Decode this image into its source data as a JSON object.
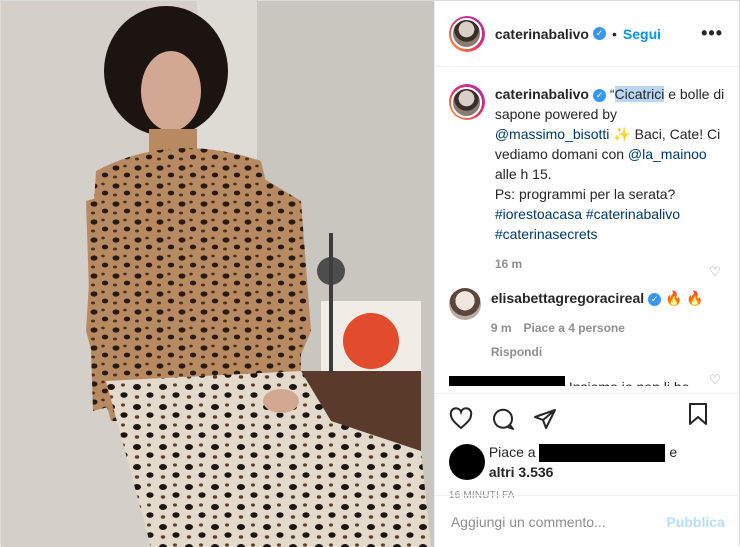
{
  "header": {
    "username": "caterinabalivo",
    "separator": "•",
    "follow_label": "Segui",
    "more_label": "•••"
  },
  "caption": {
    "username": "caterinabalivo",
    "quote": "“",
    "highlighted": "Cicatrici",
    "line1_rest": " e bolle di sapone powered by ",
    "mention1": "@massimo_bisotti",
    "sparkle": " ✨ ",
    "line2": "Baci, Cate! Ci vediamo domani con ",
    "mention2": "@la_mainoo",
    "line3": " alle h 15.",
    "line4": "Ps: programmi per la serata?",
    "hashtag1": "#iorestoacasa",
    "hashtag2": "#caterinabalivo",
    "hashtag3": "#caterinasecrets",
    "age": "16 m"
  },
  "comment1": {
    "username": "elisabettagregoracireal",
    "text": "🔥 🔥",
    "age": "9 m",
    "likes": "Piace a 4 persone",
    "reply": "Rispondi"
  },
  "comment2": {
    "text": "Insieme io non li ho"
  },
  "likes": {
    "prefix": "Piace a",
    "suffix": "e",
    "others": "altri 3.536"
  },
  "timestamp": "16 MINUTI FA",
  "add_comment": {
    "placeholder": "Aggiungi un commento...",
    "publish_label": "Pubblica"
  },
  "colors": {
    "accent": "#0095f6",
    "verified": "#3897f0",
    "muted": "#8e8e8e",
    "link": "#00376b"
  },
  "icons": [
    "heart-icon",
    "comment-icon",
    "share-icon",
    "bookmark-icon",
    "verified-icon",
    "more-icon"
  ]
}
